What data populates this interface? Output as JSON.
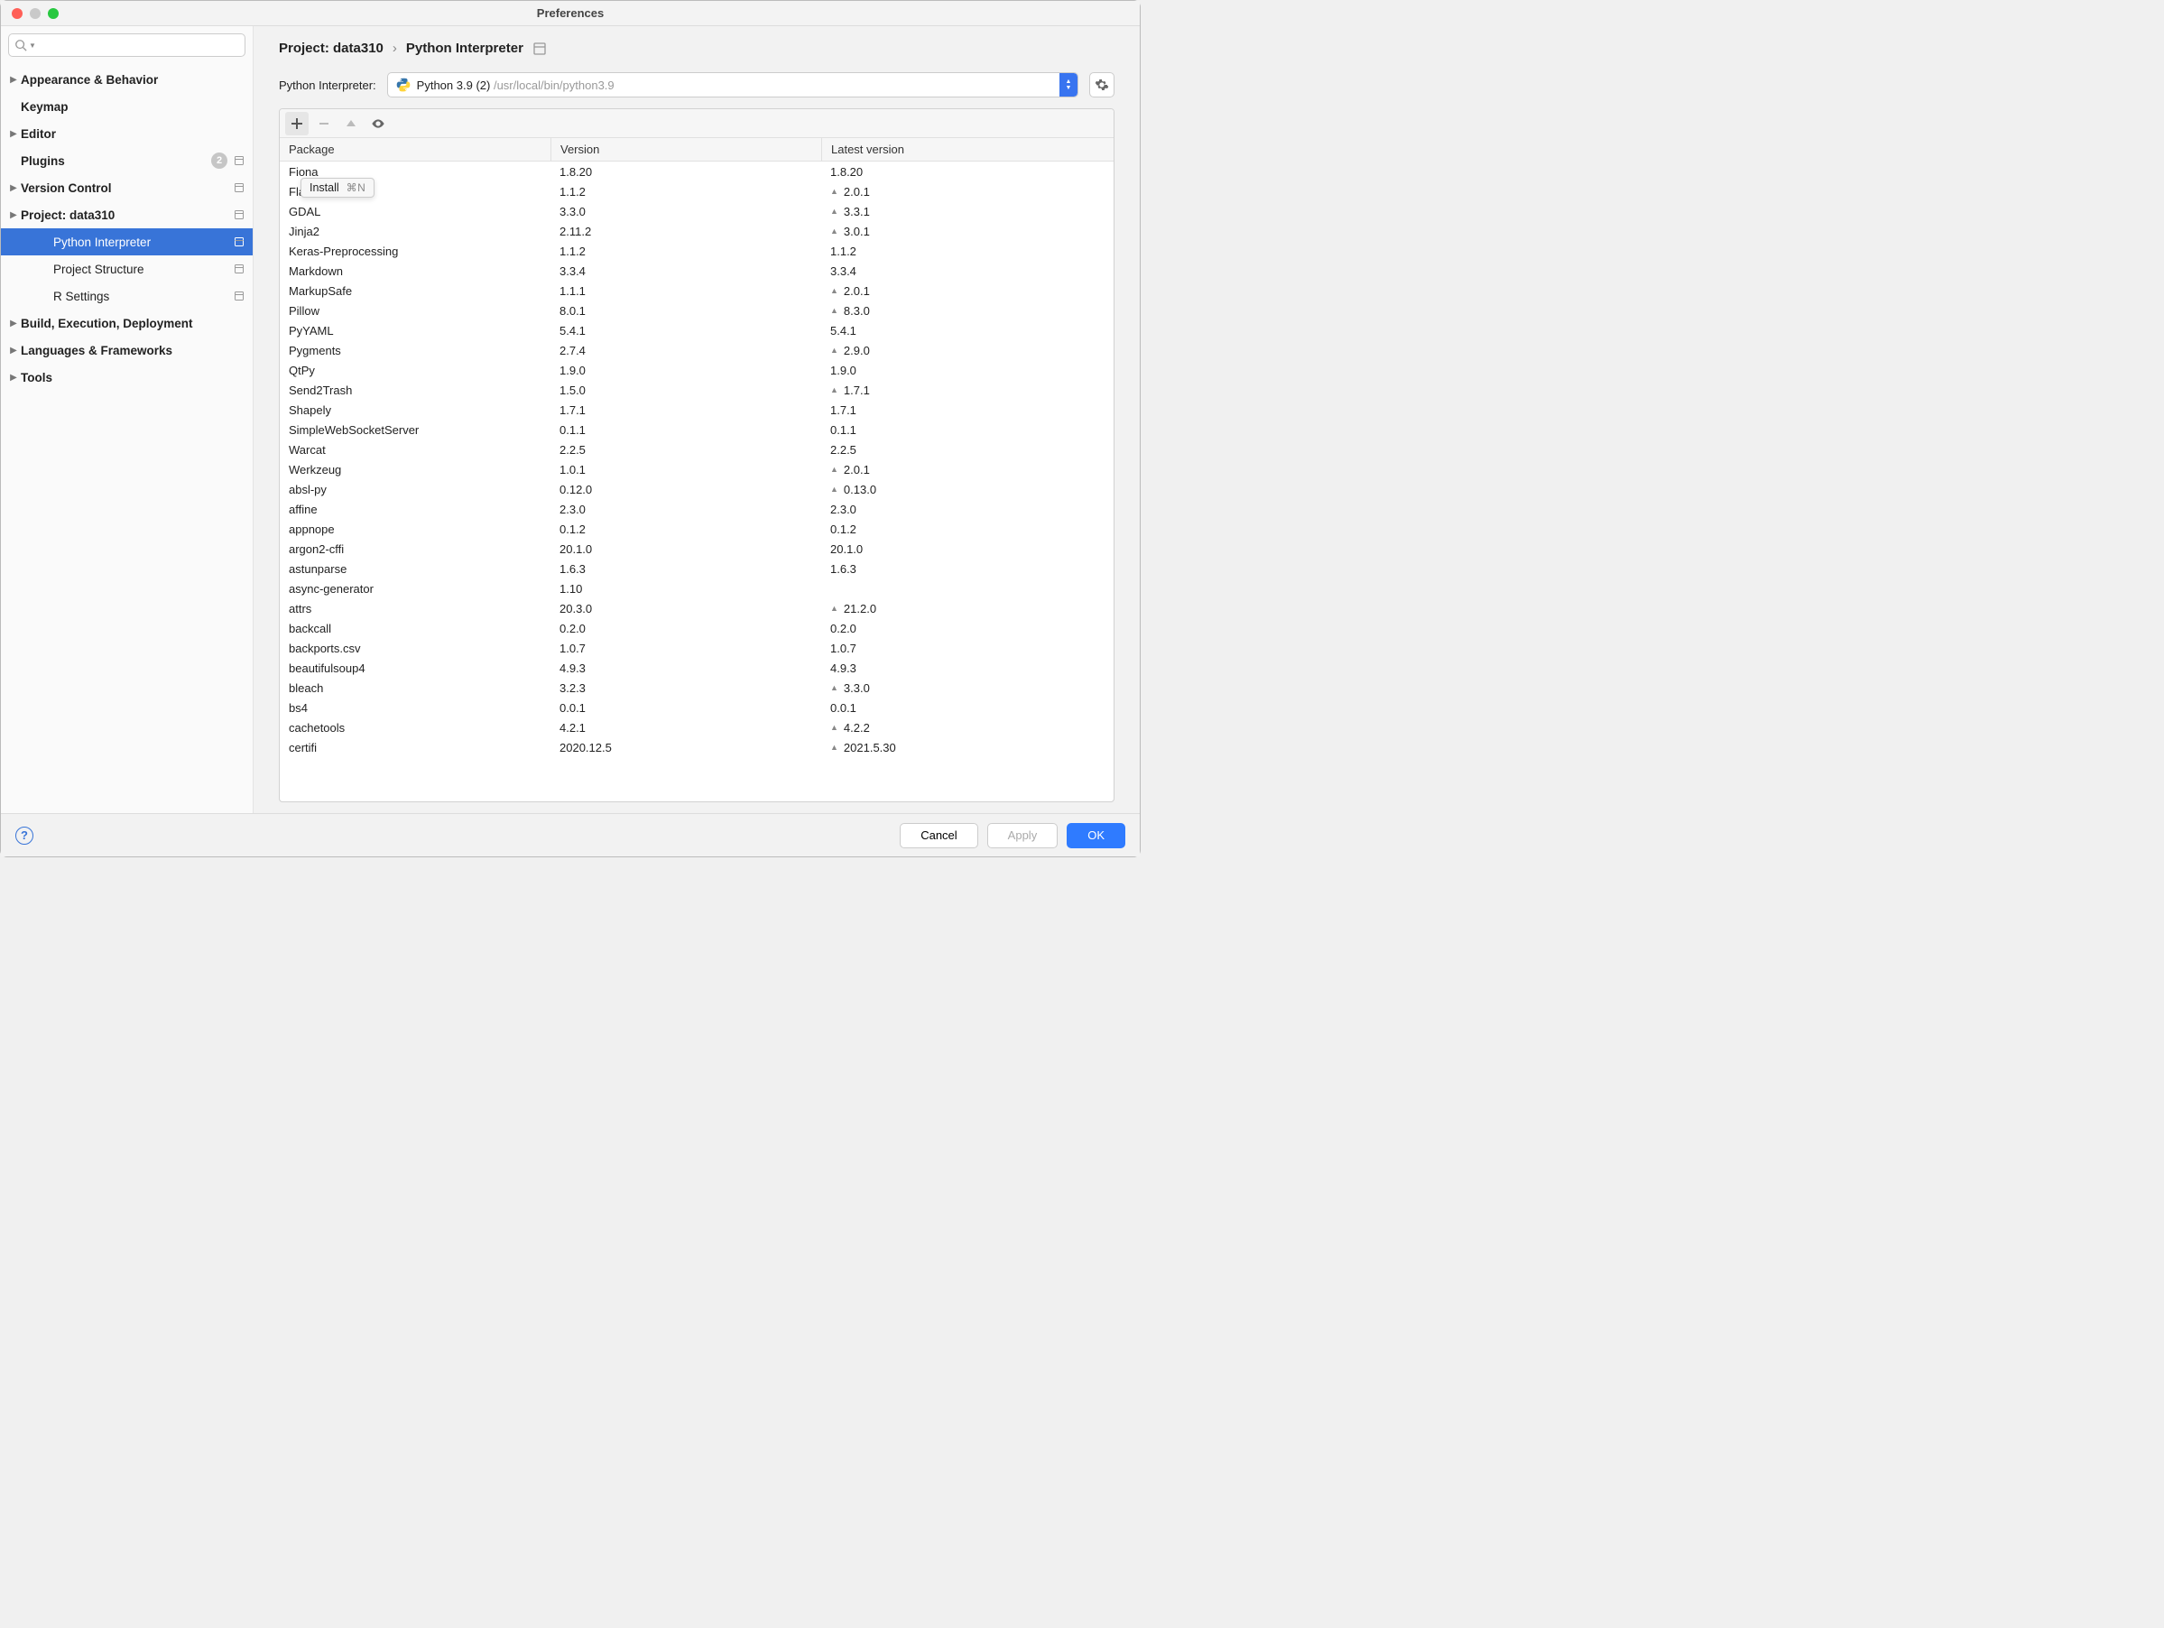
{
  "window": {
    "title": "Preferences"
  },
  "sidebar": {
    "search_placeholder": "",
    "items": [
      {
        "label": "Appearance & Behavior",
        "expandable": true
      },
      {
        "label": "Keymap"
      },
      {
        "label": "Editor",
        "expandable": true
      },
      {
        "label": "Plugins",
        "badge": "2",
        "suffix": true
      },
      {
        "label": "Version Control",
        "expandable": true,
        "suffix": true
      },
      {
        "label": "Project: data310",
        "expandable": true,
        "expanded": true,
        "suffix": true
      },
      {
        "label": "Python Interpreter",
        "child": true,
        "selected": true,
        "suffix": true
      },
      {
        "label": "Project Structure",
        "child": true,
        "suffix": true
      },
      {
        "label": "R Settings",
        "child": true,
        "suffix": true
      },
      {
        "label": "Build, Execution, Deployment",
        "expandable": true
      },
      {
        "label": "Languages & Frameworks",
        "expandable": true
      },
      {
        "label": "Tools",
        "expandable": true
      }
    ]
  },
  "breadcrumb": {
    "seg1": "Project: data310",
    "sep": "›",
    "seg2": "Python Interpreter"
  },
  "interpreter": {
    "label": "Python Interpreter:",
    "name": "Python 3.9 (2)",
    "path": "/usr/local/bin/python3.9"
  },
  "tooltip": {
    "text": "Install",
    "shortcut": "⌘N"
  },
  "table": {
    "headers": {
      "pkg": "Package",
      "ver": "Version",
      "lat": "Latest version"
    },
    "rows": [
      {
        "pkg": "Fiona",
        "ver": "1.8.20",
        "lat": "1.8.20"
      },
      {
        "pkg": "Flask",
        "ver": "1.1.2",
        "lat": "2.0.1",
        "upg": true
      },
      {
        "pkg": "GDAL",
        "ver": "3.3.0",
        "lat": "3.3.1",
        "upg": true
      },
      {
        "pkg": "Jinja2",
        "ver": "2.11.2",
        "lat": "3.0.1",
        "upg": true
      },
      {
        "pkg": "Keras-Preprocessing",
        "ver": "1.1.2",
        "lat": "1.1.2"
      },
      {
        "pkg": "Markdown",
        "ver": "3.3.4",
        "lat": "3.3.4"
      },
      {
        "pkg": "MarkupSafe",
        "ver": "1.1.1",
        "lat": "2.0.1",
        "upg": true
      },
      {
        "pkg": "Pillow",
        "ver": "8.0.1",
        "lat": "8.3.0",
        "upg": true
      },
      {
        "pkg": "PyYAML",
        "ver": "5.4.1",
        "lat": "5.4.1"
      },
      {
        "pkg": "Pygments",
        "ver": "2.7.4",
        "lat": "2.9.0",
        "upg": true
      },
      {
        "pkg": "QtPy",
        "ver": "1.9.0",
        "lat": "1.9.0"
      },
      {
        "pkg": "Send2Trash",
        "ver": "1.5.0",
        "lat": "1.7.1",
        "upg": true
      },
      {
        "pkg": "Shapely",
        "ver": "1.7.1",
        "lat": "1.7.1"
      },
      {
        "pkg": "SimpleWebSocketServer",
        "ver": "0.1.1",
        "lat": "0.1.1"
      },
      {
        "pkg": "Warcat",
        "ver": "2.2.5",
        "lat": "2.2.5"
      },
      {
        "pkg": "Werkzeug",
        "ver": "1.0.1",
        "lat": "2.0.1",
        "upg": true
      },
      {
        "pkg": "absl-py",
        "ver": "0.12.0",
        "lat": "0.13.0",
        "upg": true
      },
      {
        "pkg": "affine",
        "ver": "2.3.0",
        "lat": "2.3.0"
      },
      {
        "pkg": "appnope",
        "ver": "0.1.2",
        "lat": "0.1.2"
      },
      {
        "pkg": "argon2-cffi",
        "ver": "20.1.0",
        "lat": "20.1.0"
      },
      {
        "pkg": "astunparse",
        "ver": "1.6.3",
        "lat": "1.6.3"
      },
      {
        "pkg": "async-generator",
        "ver": "1.10",
        "lat": ""
      },
      {
        "pkg": "attrs",
        "ver": "20.3.0",
        "lat": "21.2.0",
        "upg": true
      },
      {
        "pkg": "backcall",
        "ver": "0.2.0",
        "lat": "0.2.0"
      },
      {
        "pkg": "backports.csv",
        "ver": "1.0.7",
        "lat": "1.0.7"
      },
      {
        "pkg": "beautifulsoup4",
        "ver": "4.9.3",
        "lat": "4.9.3"
      },
      {
        "pkg": "bleach",
        "ver": "3.2.3",
        "lat": "3.3.0",
        "upg": true
      },
      {
        "pkg": "bs4",
        "ver": "0.0.1",
        "lat": "0.0.1"
      },
      {
        "pkg": "cachetools",
        "ver": "4.2.1",
        "lat": "4.2.2",
        "upg": true
      },
      {
        "pkg": "certifi",
        "ver": "2020.12.5",
        "lat": "2021.5.30",
        "upg": true
      }
    ]
  },
  "footer": {
    "cancel": "Cancel",
    "apply": "Apply",
    "ok": "OK"
  }
}
